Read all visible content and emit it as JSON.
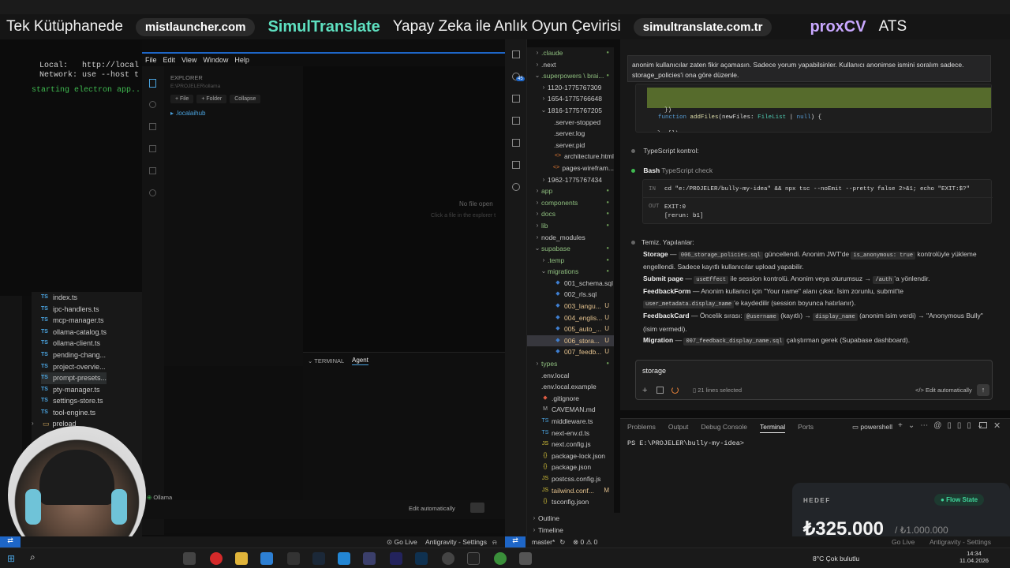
{
  "banner": {
    "left_text": "Tek Kütüphanede",
    "pill1": "mistlauncher.com",
    "brand": "SimulTranslate",
    "mid_text": "Yapay Zeka ile Anlık Oyun Çevirisi",
    "pill2": "simultranslate.com.tr",
    "brand2": "proxCV",
    "right_text": "ATS"
  },
  "left_terminal": {
    "lines": [
      "  Local:   http://local",
      "  Network: use --host t"
    ],
    "starting": "starting electron app..."
  },
  "left_files": [
    "index.ts",
    "ipc-handlers.ts",
    "mcp-manager.ts",
    "ollama-catalog.ts",
    "ollama-client.ts",
    "pending-chang...",
    "project-overvie...",
    "prompt-presets...",
    "pty-manager.ts",
    "settings-store.ts",
    "tool-engine.ts"
  ],
  "left_folder": "preload",
  "mid_window": {
    "menu": [
      "File",
      "Edit",
      "View",
      "Window",
      "Help"
    ],
    "explorer_title": "EXPLORER",
    "explorer_path": "E:\\PROJELER\\ollama",
    "buttons": [
      "+ File",
      "+ Folder",
      "Collapse"
    ],
    "folder": ".localaihub",
    "no_file": "No file open",
    "no_file_hint": "Click a file in the explorer t",
    "panel_tabs": [
      "TERMINAL",
      "Agent"
    ],
    "status_ollama": "Ollama",
    "edit_auto": "Edit automatically"
  },
  "tree": [
    {
      "name": ".claude",
      "indent": 1,
      "arrow": ">",
      "icon": "",
      "status": "dot"
    },
    {
      "name": ".next",
      "indent": 1,
      "arrow": ">",
      "icon": "",
      "status": ""
    },
    {
      "name": ".superpowers \\ brai...",
      "indent": 1,
      "arrow": "v",
      "icon": "",
      "status": "dot"
    },
    {
      "name": "1120-1775767309",
      "indent": 2,
      "arrow": ">",
      "icon": "",
      "status": ""
    },
    {
      "name": "1654-1775766648",
      "indent": 2,
      "arrow": ">",
      "icon": "",
      "status": ""
    },
    {
      "name": "1816-1775767205",
      "indent": 2,
      "arrow": "v",
      "icon": "",
      "status": ""
    },
    {
      "name": ".server-stopped",
      "indent": 3,
      "arrow": "",
      "icon": "",
      "status": ""
    },
    {
      "name": ".server.log",
      "indent": 3,
      "arrow": "",
      "icon": "",
      "status": ""
    },
    {
      "name": ".server.pid",
      "indent": 3,
      "arrow": "",
      "icon": "",
      "status": ""
    },
    {
      "name": "architecture.html",
      "indent": 3,
      "arrow": "",
      "icon": "<>",
      "status": ""
    },
    {
      "name": "pages-wirefram...",
      "indent": 3,
      "arrow": "",
      "icon": "<>",
      "status": ""
    },
    {
      "name": "1962-1775767434",
      "indent": 2,
      "arrow": ">",
      "icon": "",
      "status": ""
    },
    {
      "name": "app",
      "indent": 1,
      "arrow": ">",
      "icon": "",
      "status": "dot"
    },
    {
      "name": "components",
      "indent": 1,
      "arrow": ">",
      "icon": "",
      "status": "dot"
    },
    {
      "name": "docs",
      "indent": 1,
      "arrow": ">",
      "icon": "",
      "status": "dot"
    },
    {
      "name": "lib",
      "indent": 1,
      "arrow": ">",
      "icon": "",
      "status": "dot"
    },
    {
      "name": "node_modules",
      "indent": 1,
      "arrow": ">",
      "icon": "",
      "status": ""
    },
    {
      "name": "supabase",
      "indent": 1,
      "arrow": "v",
      "icon": "",
      "status": "dot"
    },
    {
      "name": ".temp",
      "indent": 2,
      "arrow": ">",
      "icon": "",
      "status": "dot"
    },
    {
      "name": "migrations",
      "indent": 2,
      "arrow": "v",
      "icon": "",
      "status": "dot"
    },
    {
      "name": "001_schema.sql",
      "indent": 3,
      "arrow": "",
      "icon": "db",
      "status": ""
    },
    {
      "name": "002_rls.sql",
      "indent": 3,
      "arrow": "",
      "icon": "db",
      "status": ""
    },
    {
      "name": "003_langu...",
      "indent": 3,
      "arrow": "",
      "icon": "db",
      "status": "U"
    },
    {
      "name": "004_englis...",
      "indent": 3,
      "arrow": "",
      "icon": "db",
      "status": "U"
    },
    {
      "name": "005_auto_...",
      "indent": 3,
      "arrow": "",
      "icon": "db",
      "status": "U"
    },
    {
      "name": "006_stora...",
      "indent": 3,
      "arrow": "",
      "icon": "db",
      "status": "U",
      "selected": true
    },
    {
      "name": "007_feedb...",
      "indent": 3,
      "arrow": "",
      "icon": "db",
      "status": "U"
    },
    {
      "name": "types",
      "indent": 1,
      "arrow": ">",
      "icon": "",
      "status": "dot"
    },
    {
      "name": ".env.local",
      "indent": 1,
      "arrow": "",
      "icon": "",
      "status": ""
    },
    {
      "name": ".env.local.example",
      "indent": 1,
      "arrow": "",
      "icon": "",
      "status": ""
    },
    {
      "name": ".gitignore",
      "indent": 1,
      "arrow": "",
      "icon": "git",
      "status": ""
    },
    {
      "name": "CAVEMAN.md",
      "indent": 1,
      "arrow": "",
      "icon": "md",
      "status": ""
    },
    {
      "name": "middleware.ts",
      "indent": 1,
      "arrow": "",
      "icon": "TS",
      "status": ""
    },
    {
      "name": "next-env.d.ts",
      "indent": 1,
      "arrow": "",
      "icon": "TS",
      "status": ""
    },
    {
      "name": "next.config.js",
      "indent": 1,
      "arrow": "",
      "icon": "JS",
      "status": ""
    },
    {
      "name": "package-lock.json",
      "indent": 1,
      "arrow": "",
      "icon": "{}",
      "status": ""
    },
    {
      "name": "package.json",
      "indent": 1,
      "arrow": "",
      "icon": "{}",
      "status": ""
    },
    {
      "name": "postcss.config.js",
      "indent": 1,
      "arrow": "",
      "icon": "JS",
      "status": ""
    },
    {
      "name": "tailwind.conf...",
      "indent": 1,
      "arrow": "",
      "icon": "JS",
      "status": "M"
    },
    {
      "name": "tsconfig.json",
      "indent": 1,
      "arrow": "",
      "icon": "{}",
      "status": ""
    }
  ],
  "outline": "Outline",
  "timeline": "Timeline",
  "chat": {
    "tooltip": "anonim kullanıcılar zaten fikir açamasın. Sadece yorum yapabilsinler. Kullanıcı anonimse ismini soralım sadece. storage_policies'i ona göre düzenle.",
    "code_lines": [
      "    })",
      "  }, [])",
      "",
      "  function addFiles(newFiles: FileList | null) {"
    ],
    "ts_control": "TypeScript kontrol:",
    "bash_label": "Bash",
    "bash_title": "TypeScript check",
    "in_label": "IN",
    "in_cmd": "cd \"e:/PROJELER/bully-my-idea\" && npx tsc --noEmit --pretty false 2>&1; echo \"EXIT:$?\"",
    "out_label": "OUT",
    "out_lines": [
      "EXIT:0",
      "[rerun: b1]"
    ],
    "done": "Temiz. Yapılanlar:",
    "storage_b": "Storage",
    "storage_c1": "006_storage_policies.sql",
    "storage_t1": " güncellendi. Anonim JWT'de ",
    "storage_c2": "is_anonymous: true",
    "storage_t2": " kontrolüyle yükleme",
    "storage_t3": "engellendi. Sadece kayıtlı kullanıcılar upload yapabilir.",
    "submit_b": "Submit page",
    "submit_c1": "useEffect",
    "submit_t1": " ile session kontrolü. Anonim veya oturumsuz → ",
    "submit_c2": "/auth",
    "submit_t2": "'a yönlendir.",
    "ff_b": "FeedbackForm",
    "ff_t1": " — Anonim kullanıcı için \"Your name\" alanı çıkar. İsim zorunlu, submit'te",
    "ff_c1": "user_metadata.display_name",
    "ff_t2": "'e kaydedilir (session boyunca hatırlanır).",
    "fc_b": "FeedbackCard",
    "fc_t1": " — Öncelik sırası: ",
    "fc_c1": "@username",
    "fc_t2": " (kayıtlı) → ",
    "fc_c2": "display_name",
    "fc_t3": " (anonim isim verdi) → \"Anonymous Bully\"",
    "fc_t4": "(isim vermedi).",
    "mig_b": "Migration",
    "mig_c1": "007_feedback_display_name.sql",
    "mig_t1": " çalıştırman gerek (Supabase dashboard).",
    "input_value": "storage",
    "lines_selected": "21 lines selected",
    "edit_auto": "Edit automatically"
  },
  "terminal": {
    "tabs": [
      "Problems",
      "Output",
      "Debug Console",
      "Terminal",
      "Ports"
    ],
    "active_tab": "Terminal",
    "shell": "powershell",
    "prompt": "PS E:\\PROJELER\\bully-my-idea>"
  },
  "goal": {
    "label": "HEDEF",
    "badge": "Flow State",
    "amount": "₺325.000",
    "target": "/ ₺1.000.000",
    "progress": 0.325,
    "sub": "8°C  Çok bulutlu"
  },
  "status": {
    "branch": "master*",
    "problems": "⊗ 0 ⚠ 0",
    "go_live": "Go Live",
    "settings": "Antigravity - Settings",
    "go_live2": "Go Live",
    "settings2": "Antigravity - Settings"
  },
  "taskbar": {
    "time": "14:34",
    "date": "11.04.2026",
    "weather": "8°C  Çok bulutlu"
  },
  "badges": {
    "act_badge1": "45"
  },
  "colors": {
    "accent": "#1e66c7",
    "green": "#3fb950",
    "untracked": "#e2c08d",
    "teal": "#4ec9b0"
  }
}
